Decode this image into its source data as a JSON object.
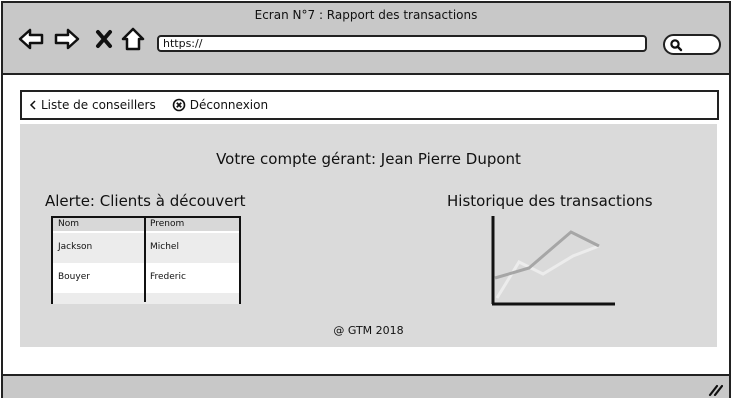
{
  "window": {
    "title": "Ecran N°7 : Rapport des transactions",
    "url": "https://"
  },
  "icons": {
    "back": "back-arrow-icon",
    "forward": "forward-arrow-icon",
    "close": "close-icon",
    "home": "home-icon",
    "search": "search-icon"
  },
  "menu": {
    "back_label": "Liste de conseillers",
    "logout_label": "Déconnexion"
  },
  "page": {
    "account": "Votre compte gérant: Jean Pierre Dupont",
    "alert_title": "Alerte: Clients à découvert",
    "history_title": "Historique des transactions",
    "footer": "@ GTM 2018"
  },
  "table": {
    "headers": [
      "Nom",
      "Prenom"
    ],
    "rows": [
      [
        "Jackson",
        "Michel"
      ],
      [
        "Bouyer",
        "Frederic"
      ]
    ]
  },
  "colors": {
    "chrome": "#c8c8c8",
    "panel": "#dadada",
    "chart_line": "#a6a6a6",
    "chart_line_light": "#e4e4e4"
  }
}
